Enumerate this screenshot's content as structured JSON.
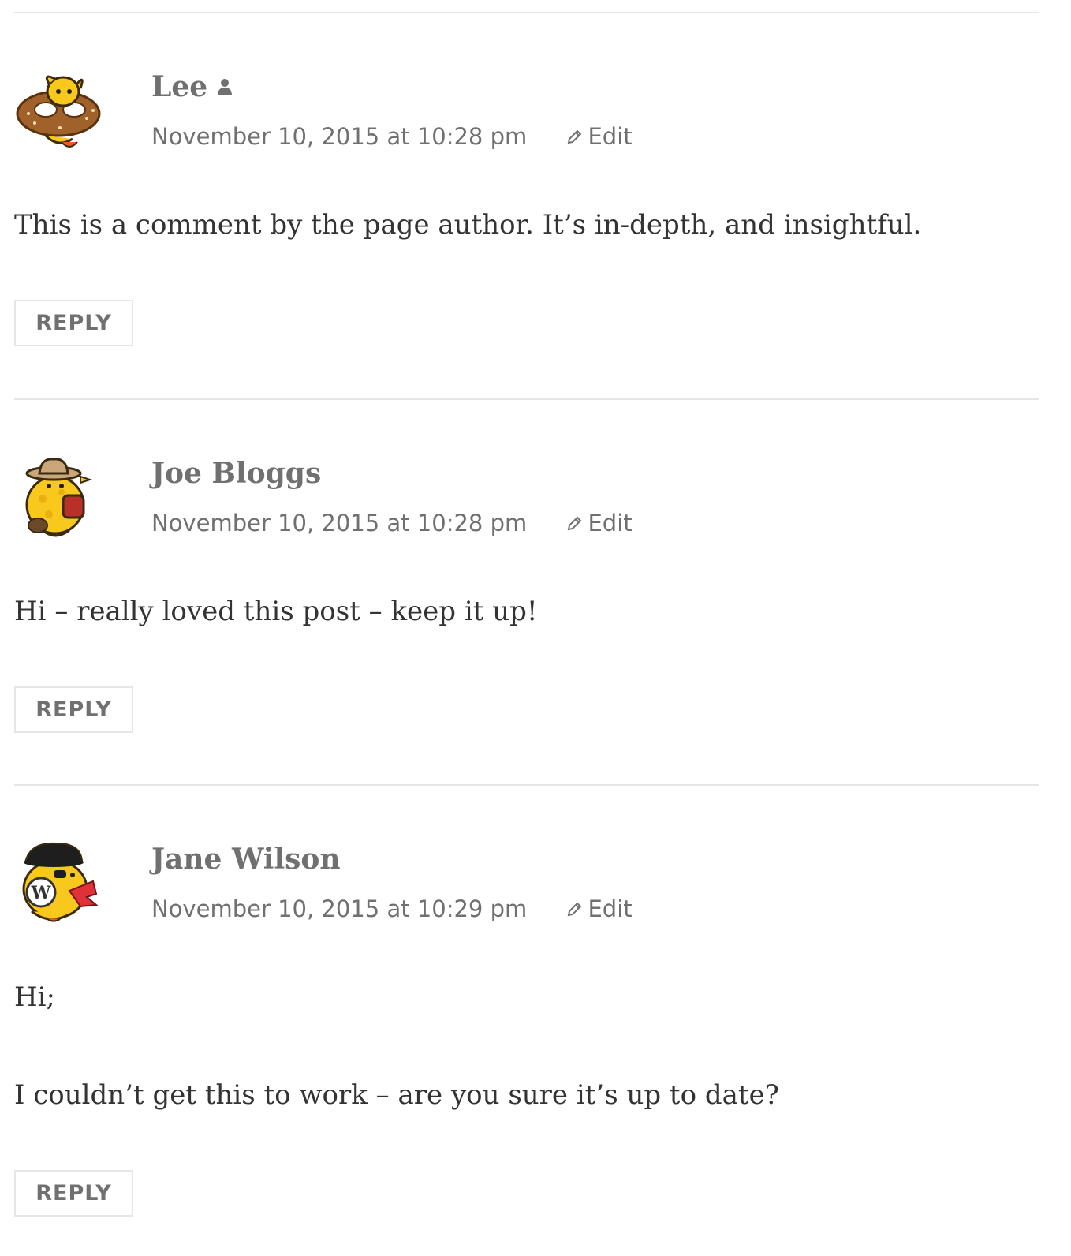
{
  "comments": [
    {
      "author": "Lee",
      "is_post_author": true,
      "date": "November 10, 2015 at 10:28 pm",
      "edit_label": "Edit",
      "paragraphs": [
        "This is a comment by the page author. It’s in-depth, and insightful."
      ],
      "reply_label": "REPLY",
      "avatar_icon": "wapuu-pretzel-avatar"
    },
    {
      "author": "Joe Bloggs",
      "is_post_author": false,
      "date": "November 10, 2015 at 10:28 pm",
      "edit_label": "Edit",
      "paragraphs": [
        "Hi – really loved this post – keep it up!"
      ],
      "reply_label": "REPLY",
      "avatar_icon": "wapuu-cowboy-avatar"
    },
    {
      "author": "Jane Wilson",
      "is_post_author": false,
      "date": "November 10, 2015 at 10:29 pm",
      "edit_label": "Edit",
      "paragraphs": [
        "Hi;",
        "I couldn’t get this to work – are you sure it’s up to date?"
      ],
      "reply_label": "REPLY",
      "avatar_icon": "wapuu-pirate-avatar"
    }
  ],
  "colors": {
    "meta_text": "#707070",
    "body_text": "#333333",
    "divider": "#e6e6e6",
    "wapuu_yellow": "#f8c81c"
  }
}
